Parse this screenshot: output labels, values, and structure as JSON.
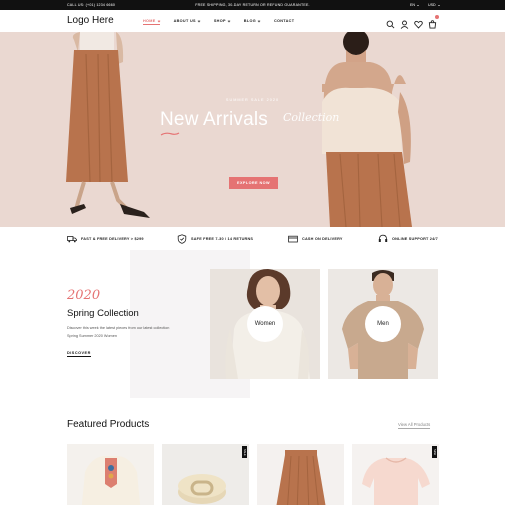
{
  "topbar": {
    "call": "CALL US: (+01) 1234 6660",
    "promo": "FREE SHIPPING, 30-DAY RETURN OR REFUND GUARANTEE.",
    "language": "EN",
    "currency": "USD"
  },
  "header": {
    "logo": "Logo Here",
    "nav": [
      {
        "label": "HOME",
        "active": true
      },
      {
        "label": "ABOUT US"
      },
      {
        "label": "SHOP"
      },
      {
        "label": "BLOG"
      },
      {
        "label": "CONTACT"
      }
    ],
    "icons": [
      "search-icon",
      "user-icon",
      "heart-icon",
      "cart-icon"
    ],
    "cart_count": "0"
  },
  "hero": {
    "subtitle": "SUMMER SALE 2020",
    "title": "New Arrivals",
    "script": "Collection",
    "button": "EXPLORE NOW"
  },
  "features": [
    {
      "icon": "truck-icon",
      "label": "FAST & FREE DELIVERY > $299"
    },
    {
      "icon": "shield-icon",
      "label": "SAFE FREE 7-30 / 14 RETURNS"
    },
    {
      "icon": "card-icon",
      "label": "CASH ON DELIVERY"
    },
    {
      "icon": "headset-icon",
      "label": "ONLINE SUPPORT 24/7"
    }
  ],
  "spring": {
    "year": "2020",
    "title": "Spring Collection",
    "description": "Discover this week the latest pieces from our latest collection Spring Summer 2020 Women",
    "cta": "DISCOVER"
  },
  "categories": [
    {
      "label": "Women"
    },
    {
      "label": "Men"
    }
  ],
  "featured": {
    "title": "Featured Products",
    "view_all": "View All Products",
    "tags": [
      "SALE",
      "NEW"
    ]
  },
  "colors": {
    "accent": "#e57373",
    "hero_bg": "#ead8d1",
    "topbar": "#111111"
  }
}
